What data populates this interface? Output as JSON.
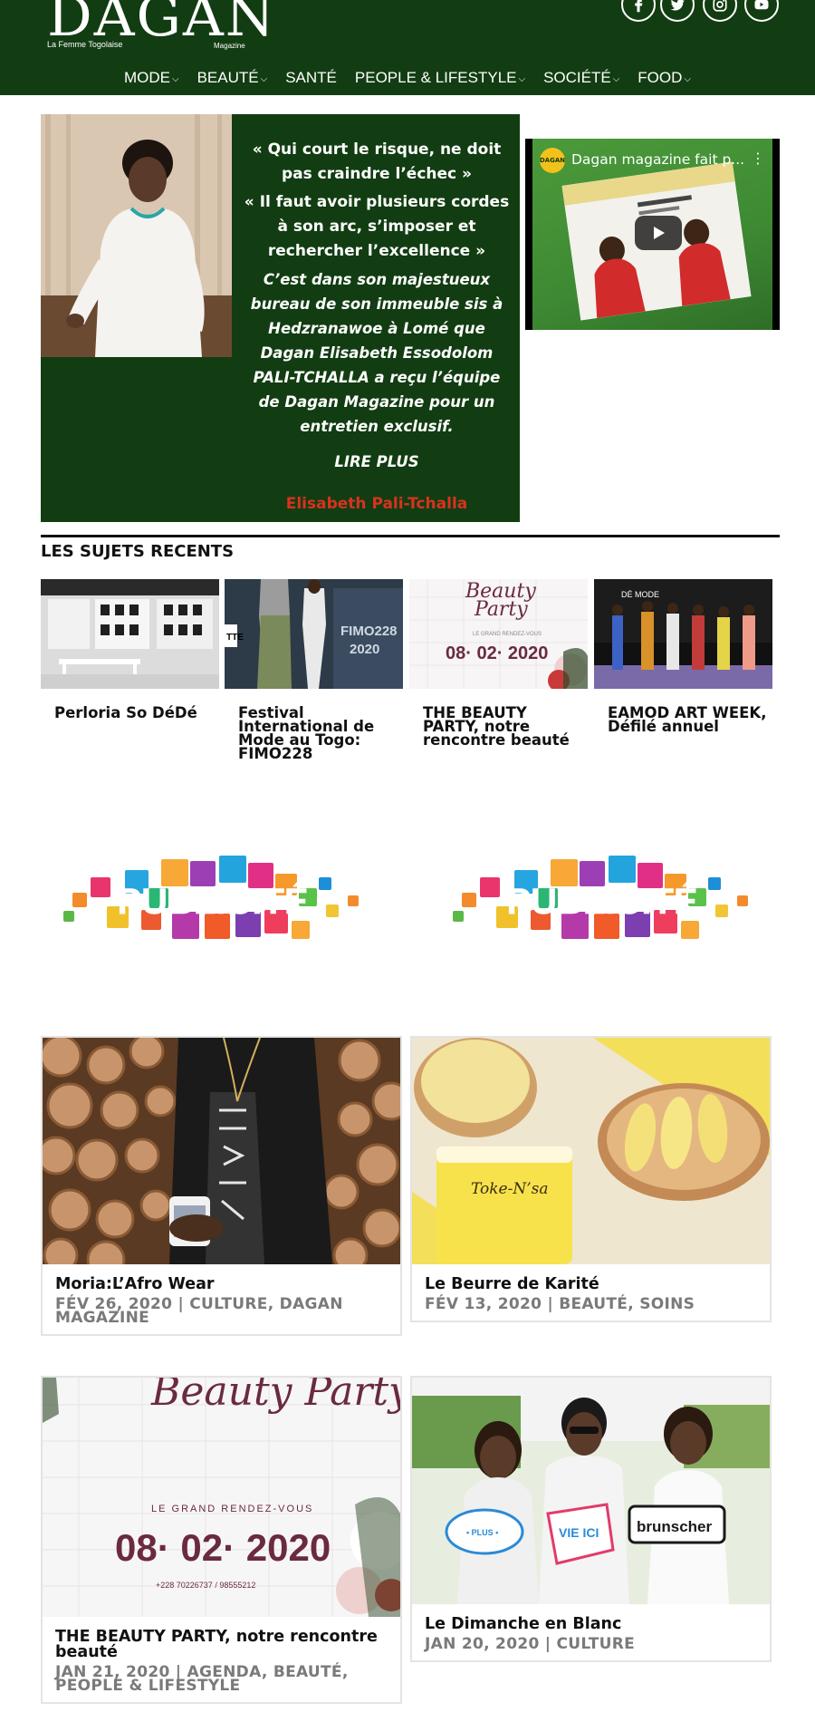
{
  "header": {
    "logo": "DAGAN",
    "logo_sub": "La Femme Togolaise",
    "logo_mag": "Magazine",
    "social": [
      {
        "icon": "facebook-icon"
      },
      {
        "icon": "twitter-icon"
      },
      {
        "icon": "instagram-icon"
      },
      {
        "icon": "youtube-icon"
      }
    ]
  },
  "nav": {
    "items": [
      {
        "label": "MODE",
        "has_dropdown": true
      },
      {
        "label": "BEAUTÉ",
        "has_dropdown": true
      },
      {
        "label": "SANTÉ",
        "has_dropdown": false
      },
      {
        "label": "PEOPLE & LIFESTYLE",
        "has_dropdown": true
      },
      {
        "label": "SOCIÉTÉ",
        "has_dropdown": true
      },
      {
        "label": "FOOD",
        "has_dropdown": true
      }
    ]
  },
  "feature": {
    "quote1": "« Qui court le risque, ne doit pas craindre l’échec »",
    "quote2": "« Il faut avoir plusieurs cordes à son arc, s’imposer et rechercher l’excellence »",
    "description": "C’est dans son majestueux bureau de son immeuble sis à Hedzranawoe à Lomé que Dagan Elisabeth Essodolom PALI-TCHALLA a reçu l’équipe de Dagan Magazine pour un entretien exclusif.",
    "read_more": "LIRE PLUS",
    "name": "Elisabeth Pali-Tchalla"
  },
  "video": {
    "title": "Dagan magazine fait p...",
    "channel_logo": "DAGAN"
  },
  "recent": {
    "heading": "LES SUJETS RECENTS",
    "items": [
      {
        "title": "Perloria So DéDé"
      },
      {
        "title": "Festival International de Mode au Togo: FIMO228"
      },
      {
        "title": "THE BEAUTY PARTY, notre rencontre beauté"
      },
      {
        "title": "EAMOD ART WEEK, Défilé annuel"
      }
    ],
    "image_texts": {
      "fimo": "FIMO228\n2020",
      "beauty_script": "Beauty Party",
      "beauty_date": "08· 02· 2020",
      "beauty_sub": "LE GRAND RENDEZ-VOUS"
    }
  },
  "ads": [
    {
      "text": "PUBLICITÉ"
    },
    {
      "text": "PUBLICITÉ"
    }
  ],
  "cards": [
    {
      "title": "Moria:L’Afro Wear",
      "meta": "FÉV 26, 2020 | CULTURE, DAGAN MAGAZINE"
    },
    {
      "title": "Le Beurre de Karité",
      "meta": "FÉV 13, 2020 | BEAUTÉ, SOINS"
    },
    {
      "title": "THE BEAUTY PARTY, notre rencontre beauté",
      "meta": "JAN 21, 2020 | AGENDA, BEAUTÉ, PEOPLE & LIFESTYLE"
    },
    {
      "title": "Le Dimanche en Blanc",
      "meta": "JAN 20, 2020 | CULTURE"
    }
  ],
  "card_image_texts": {
    "toke": "Toke-N’sa",
    "beauty_script": "Beauty Party",
    "beauty_sub": "LE GRAND RENDEZ-VOUS",
    "beauty_date": "08· 02· 2020",
    "beauty_phone": "+228 70226737 / 98555212",
    "sign1": "VIE ICI",
    "sign2": "brunscher"
  },
  "colors": {
    "brand_green": "#123d12",
    "accent_red": "#d8321f"
  }
}
